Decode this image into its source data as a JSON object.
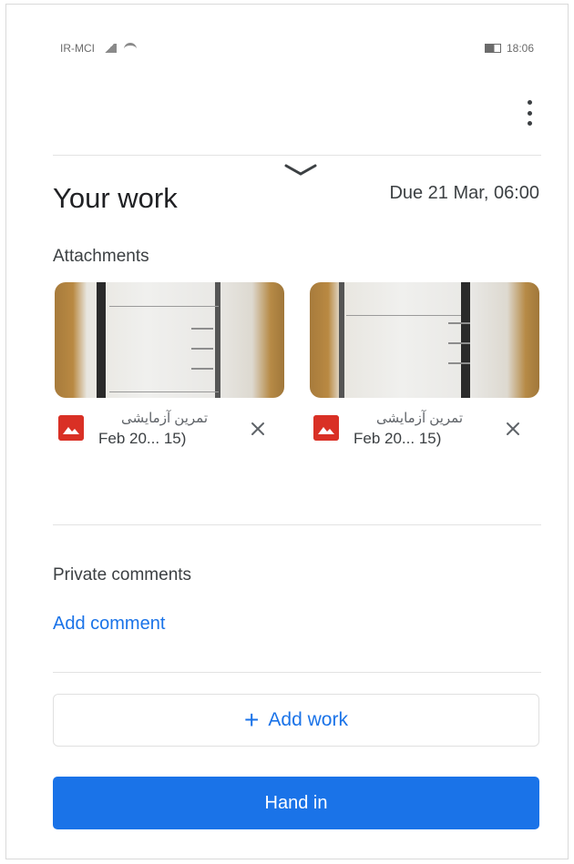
{
  "status_bar": {
    "carrier": "IR-MCI",
    "time": "18:06"
  },
  "header": {
    "more_icon": "more-vert-icon"
  },
  "your_work": {
    "title": "Your work",
    "due": "Due 21 Mar, 06:00",
    "attachments_label": "Attachments",
    "attachments": [
      {
        "name": "تمرین آزمایشی",
        "date": "Feb 20... 15)",
        "icon": "image-file-icon"
      },
      {
        "name": "تمرین آزمایشی",
        "date": "Feb 20... 15)",
        "icon": "image-file-icon"
      }
    ]
  },
  "comments": {
    "label": "Private comments",
    "add_comment": "Add comment"
  },
  "actions": {
    "add_work_plus": "+",
    "add_work": "Add work",
    "hand_in": "Hand in"
  },
  "colors": {
    "accent": "#1a73e8",
    "file_icon": "#d93025",
    "text": "#202124"
  }
}
